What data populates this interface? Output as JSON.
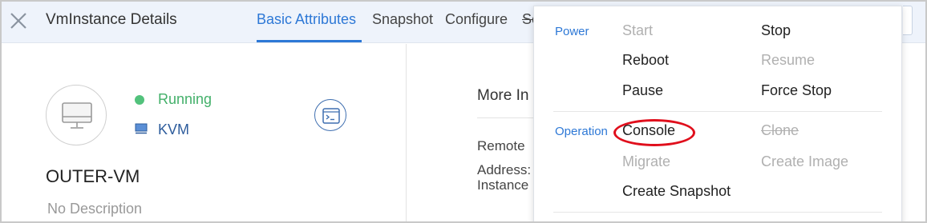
{
  "header": {
    "title": "VmInstance Details",
    "tabs": [
      {
        "label": "Basic Attributes",
        "active": true
      },
      {
        "label": "Snapshot",
        "active": false
      },
      {
        "label": "Configure",
        "active": false
      }
    ],
    "clipped_tab": "Se"
  },
  "vm": {
    "status": "Running",
    "hypervisor": "KVM",
    "name": "OUTER-VM",
    "description": "No Description"
  },
  "details": {
    "more_info": "More In",
    "remote": "Remote",
    "address": "Address:",
    "instance": "Instance"
  },
  "actions_menu": {
    "power": {
      "label": "Power",
      "start": "Start",
      "stop": "Stop",
      "reboot": "Reboot",
      "resume": "Resume",
      "pause": "Pause",
      "force_stop": "Force Stop"
    },
    "operation": {
      "label": "Operation",
      "console": "Console",
      "clone": "Clone",
      "migrate": "Migrate",
      "create_image": "Create Image",
      "create_snapshot": "Create Snapshot"
    }
  },
  "colors": {
    "accent": "#2d78d6",
    "running": "#43b06a",
    "highlight": "#e00f1c",
    "disabled": "#b0b0b0",
    "header_bg": "#eef3fb"
  },
  "icons": {
    "close": "close-icon",
    "vm": "monitor-icon",
    "hypervisor": "kvm-icon",
    "console": "terminal-icon"
  }
}
